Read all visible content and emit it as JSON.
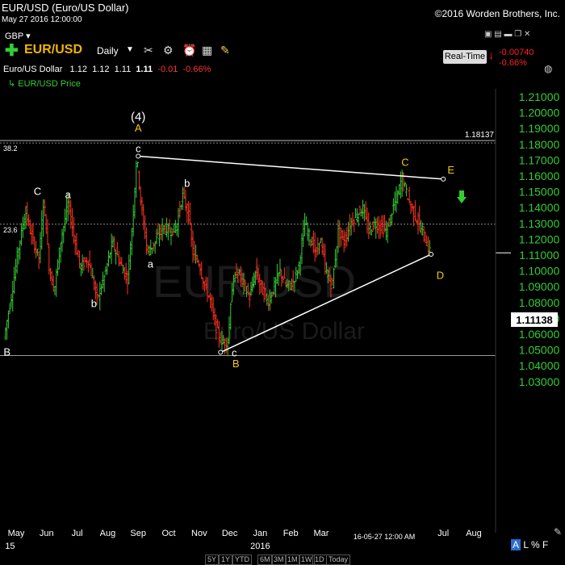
{
  "header": {
    "title": "EUR/USD (Euro/US Dollar)",
    "datetime": "May 27 2016 12:00:00",
    "copyright": "©2016 Worden Brothers, Inc.",
    "currency": "GBP"
  },
  "toolbar": {
    "symbol": "EUR/USD",
    "period": "Daily",
    "realtime_label": "Real-Time",
    "change_abs": "-0.00740",
    "change_pct": "-0.66%",
    "icons": [
      "plus-icon",
      "tools-icon",
      "alarm-icon",
      "calculator-icon",
      "note-icon"
    ]
  },
  "ohlc": {
    "name": "Euro/US Dollar",
    "open": "1.12",
    "high": "1.12",
    "low": "1.11",
    "close": "1.11",
    "change": "-0.01",
    "change_pct": "-0.66%"
  },
  "legend": {
    "series": "EUR/USD Price"
  },
  "watermark": {
    "symbol": "EUR/USD",
    "name": "Euro/US Dollar"
  },
  "chart_data": {
    "type": "bar",
    "yticks": [
      "1.21000",
      "1.20000",
      "1.19000",
      "1.18000",
      "1.17000",
      "1.16000",
      "1.15000",
      "1.14000",
      "1.13000",
      "1.12000",
      "1.11000",
      "1.10000",
      "1.09000",
      "1.08000",
      "1.07000",
      "1.06000",
      "1.05000",
      "1.04000",
      "1.03000"
    ],
    "ylim": [
      1.025,
      1.215
    ],
    "xticks": [
      {
        "label": "May",
        "t": 0.0
      },
      {
        "label": "Jun",
        "t": 1.0
      },
      {
        "label": "Jul",
        "t": 2.0
      },
      {
        "label": "Aug",
        "t": 3.0
      },
      {
        "label": "Sep",
        "t": 4.0
      },
      {
        "label": "Oct",
        "t": 5.0
      },
      {
        "label": "Nov",
        "t": 6.0
      },
      {
        "label": "Dec",
        "t": 7.0
      },
      {
        "label": "Jan",
        "t": 8.0
      },
      {
        "label": "Feb",
        "t": 9.0
      },
      {
        "label": "Mar",
        "t": 10.0
      },
      {
        "label": "Jul",
        "t": 14.0
      },
      {
        "label": "Aug",
        "t": 15.0
      }
    ],
    "year_labels": [
      {
        "label": "15",
        "t": -0.2
      },
      {
        "label": "2016",
        "t": 8.0
      }
    ],
    "end_date_label": "16-05-27 12:00 AM",
    "last_price": "1.11138",
    "last_price_value": 1.11138,
    "horizontal_lines": [
      {
        "label": "1.18137",
        "value": 1.18137
      },
      {
        "label": "38.2",
        "value": 1.18137
      },
      {
        "label": "23.6",
        "value": 1.1295
      },
      {
        "label": "",
        "value": 1.0465
      }
    ],
    "trendlines": [
      {
        "from": [
          4.0,
          1.1725
        ],
        "to": [
          14.0,
          1.158
        ]
      },
      {
        "from": [
          6.7,
          1.0485
        ],
        "to": [
          13.6,
          1.1105
        ]
      }
    ],
    "price_path": [
      [
        -0.35,
        1.058
      ],
      [
        -0.1,
        1.085
      ],
      [
        0.1,
        1.112
      ],
      [
        0.35,
        1.138
      ],
      [
        0.55,
        1.122
      ],
      [
        0.8,
        1.108
      ],
      [
        0.95,
        1.146
      ],
      [
        1.15,
        1.098
      ],
      [
        1.3,
        1.088
      ],
      [
        1.5,
        1.118
      ],
      [
        1.75,
        1.143
      ],
      [
        1.95,
        1.121
      ],
      [
        2.15,
        1.102
      ],
      [
        2.4,
        1.108
      ],
      [
        2.7,
        1.082
      ],
      [
        2.95,
        1.097
      ],
      [
        3.2,
        1.118
      ],
      [
        3.45,
        1.105
      ],
      [
        3.7,
        1.095
      ],
      [
        3.85,
        1.128
      ],
      [
        4.0,
        1.1725
      ],
      [
        4.15,
        1.14
      ],
      [
        4.35,
        1.112
      ],
      [
        4.6,
        1.118
      ],
      [
        4.85,
        1.128
      ],
      [
        5.1,
        1.125
      ],
      [
        5.3,
        1.128
      ],
      [
        5.5,
        1.148
      ],
      [
        5.7,
        1.135
      ],
      [
        5.85,
        1.11
      ],
      [
        6.05,
        1.105
      ],
      [
        6.2,
        1.092
      ],
      [
        6.4,
        1.082
      ],
      [
        6.6,
        1.064
      ],
      [
        6.8,
        1.054
      ],
      [
        7.0,
        1.056
      ],
      [
        7.1,
        1.088
      ],
      [
        7.3,
        1.1
      ],
      [
        7.5,
        1.092
      ],
      [
        7.7,
        1.083
      ],
      [
        7.9,
        1.1
      ],
      [
        8.1,
        1.088
      ],
      [
        8.3,
        1.08
      ],
      [
        8.5,
        1.09
      ],
      [
        8.7,
        1.1
      ],
      [
        8.9,
        1.09
      ],
      [
        9.1,
        1.092
      ],
      [
        9.3,
        1.102
      ],
      [
        9.5,
        1.13
      ],
      [
        9.7,
        1.12
      ],
      [
        9.9,
        1.11
      ],
      [
        10.0,
        1.122
      ],
      [
        10.2,
        1.1
      ],
      [
        10.4,
        1.09
      ],
      [
        10.6,
        1.125
      ],
      [
        10.8,
        1.118
      ],
      [
        11.0,
        1.13
      ],
      [
        11.2,
        1.135
      ],
      [
        11.4,
        1.14
      ],
      [
        11.6,
        1.125
      ],
      [
        11.8,
        1.13
      ],
      [
        12.0,
        1.128
      ],
      [
        12.2,
        1.125
      ],
      [
        12.4,
        1.14
      ],
      [
        12.55,
        1.148
      ],
      [
        12.7,
        1.16
      ],
      [
        12.8,
        1.152
      ],
      [
        13.0,
        1.14
      ],
      [
        13.2,
        1.132
      ],
      [
        13.35,
        1.125
      ],
      [
        13.5,
        1.118
      ],
      [
        13.6,
        1.112
      ]
    ],
    "wave_labels": [
      {
        "text": "(4)",
        "t": 4.0,
        "value": 1.195,
        "color": "#ffffff"
      },
      {
        "text": "A",
        "t": 4.0,
        "value": 1.188,
        "color": "#f2c80f"
      },
      {
        "text": "c",
        "t": 4.0,
        "value": 1.175,
        "color": "#ffffff"
      },
      {
        "text": "C",
        "t": 0.7,
        "value": 1.148,
        "color": "#ffffff"
      },
      {
        "text": "a",
        "t": 1.7,
        "value": 1.146,
        "color": "#ffffff"
      },
      {
        "text": "b",
        "t": 5.6,
        "value": 1.153,
        "color": "#ffffff"
      },
      {
        "text": "a",
        "t": 4.4,
        "value": 1.102,
        "color": "#ffffff"
      },
      {
        "text": "b",
        "t": 2.55,
        "value": 1.077,
        "color": "#ffffff"
      },
      {
        "text": "c",
        "t": 7.15,
        "value": 1.046,
        "color": "#ffffff"
      },
      {
        "text": "B",
        "t": 7.2,
        "value": 1.039,
        "color": "#f2c80f"
      },
      {
        "text": "C",
        "t": 12.75,
        "value": 1.1665,
        "color": "#f2c80f"
      },
      {
        "text": "E",
        "t": 14.25,
        "value": 1.1615,
        "color": "#f2c80f"
      },
      {
        "text": "D",
        "t": 13.9,
        "value": 1.095,
        "color": "#f2c80f"
      },
      {
        "text": "B",
        "t": -0.3,
        "value": 1.0465,
        "color": "#ffffff"
      }
    ],
    "grid": false
  },
  "range_buttons": [
    "5Y",
    "1Y",
    "YTD",
    "6M",
    "3M",
    "1M",
    "1W",
    "1D",
    "Today"
  ],
  "scale_options": {
    "a": "A",
    "l": "L",
    "pct": "%",
    "f": "F"
  },
  "colors": {
    "background": "#000000",
    "up": "#33cc33",
    "down": "#ff3322",
    "axis_text": "#33cc33",
    "wave_yellow": "#f2c80f",
    "trendline": "#ffffff"
  }
}
